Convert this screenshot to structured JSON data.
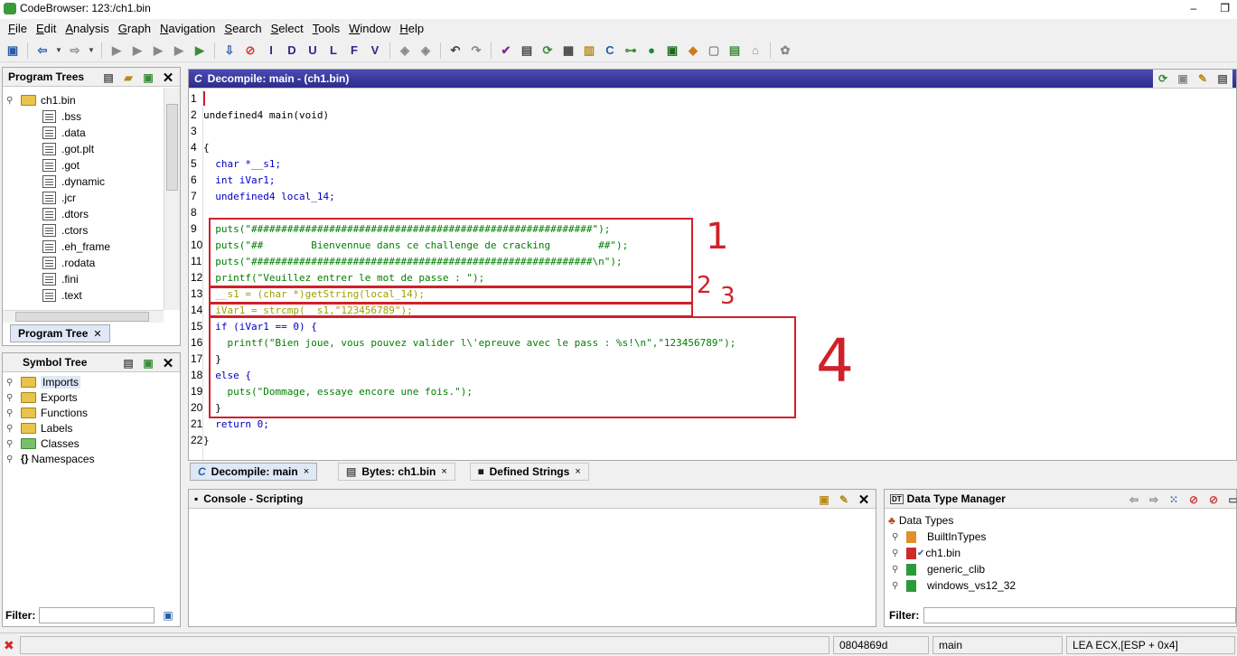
{
  "window": {
    "title": "CodeBrowser: 123:/ch1.bin",
    "minimize": "‒",
    "restore": "❐"
  },
  "menu": [
    "File",
    "Edit",
    "Analysis",
    "Graph",
    "Navigation",
    "Search",
    "Select",
    "Tools",
    "Window",
    "Help"
  ],
  "program_trees": {
    "title": "Program Trees",
    "root": "ch1.bin",
    "items": [
      ".bss",
      ".data",
      ".got.plt",
      ".got",
      ".dynamic",
      ".jcr",
      ".dtors",
      ".ctors",
      ".eh_frame",
      ".rodata",
      ".fini",
      ".text"
    ],
    "tab_label": "Program Tree"
  },
  "symbol_tree": {
    "title": "Symbol Tree",
    "items": [
      "Imports",
      "Exports",
      "Functions",
      "Labels",
      "Classes",
      "Namespaces"
    ],
    "filter_label": "Filter:"
  },
  "decompile": {
    "title": "Decompile: main -  (ch1.bin)",
    "lines": [
      {
        "n": "1",
        "t": ""
      },
      {
        "n": "2",
        "t": "undefined4 main(void)"
      },
      {
        "n": "3",
        "t": ""
      },
      {
        "n": "4",
        "t": "{"
      },
      {
        "n": "5",
        "t": "  char *__s1;"
      },
      {
        "n": "6",
        "t": "  int iVar1;"
      },
      {
        "n": "7",
        "t": "  undefined4 local_14;"
      },
      {
        "n": "8",
        "t": "  "
      },
      {
        "n": "9",
        "t": "  puts(\"#########################################################\");"
      },
      {
        "n": "10",
        "t": "  puts(\"##        Bienvennue dans ce challenge de cracking        ##\");"
      },
      {
        "n": "11",
        "t": "  puts(\"#########################################################\\n\");"
      },
      {
        "n": "12",
        "t": "  printf(\"Veuillez entrer le mot de passe : \");"
      },
      {
        "n": "13",
        "t": "  __s1 = (char *)getString(local_14);"
      },
      {
        "n": "14",
        "t": "  iVar1 = strcmp(__s1,\"123456789\");"
      },
      {
        "n": "15",
        "t": "  if (iVar1 == 0) {"
      },
      {
        "n": "16",
        "t": "    printf(\"Bien joue, vous pouvez valider l\\'epreuve avec le pass : %s!\\n\",\"123456789\");"
      },
      {
        "n": "17",
        "t": "  }"
      },
      {
        "n": "18",
        "t": "  else {"
      },
      {
        "n": "19",
        "t": "    puts(\"Dommage, essaye encore une fois.\");"
      },
      {
        "n": "20",
        "t": "  }"
      },
      {
        "n": "21",
        "t": "  return 0;"
      },
      {
        "n": "22",
        "t": "}"
      }
    ],
    "annotations": [
      "1",
      "2",
      "3",
      "4"
    ],
    "tabs": [
      {
        "label": "Decompile: main",
        "close": "×"
      },
      {
        "label": "Bytes: ch1.bin",
        "close": "×"
      },
      {
        "label": "Defined Strings",
        "close": "×"
      }
    ]
  },
  "console": {
    "title": "Console - Scripting"
  },
  "data_type_manager": {
    "title": "Data Type Manager",
    "root": "Data Types",
    "items": [
      "BuiltInTypes",
      "ch1.bin",
      "generic_clib",
      "windows_vs12_32"
    ],
    "filter_label": "Filter:"
  },
  "status": {
    "address": "0804869d",
    "function": "main",
    "instruction": "LEA ECX,[ESP + 0x4]"
  },
  "colors": {
    "accent_header": "#2d2d8a",
    "annotation_red": "#d0202a",
    "keyword_blue": "#0000c0",
    "string_green": "#008000"
  }
}
